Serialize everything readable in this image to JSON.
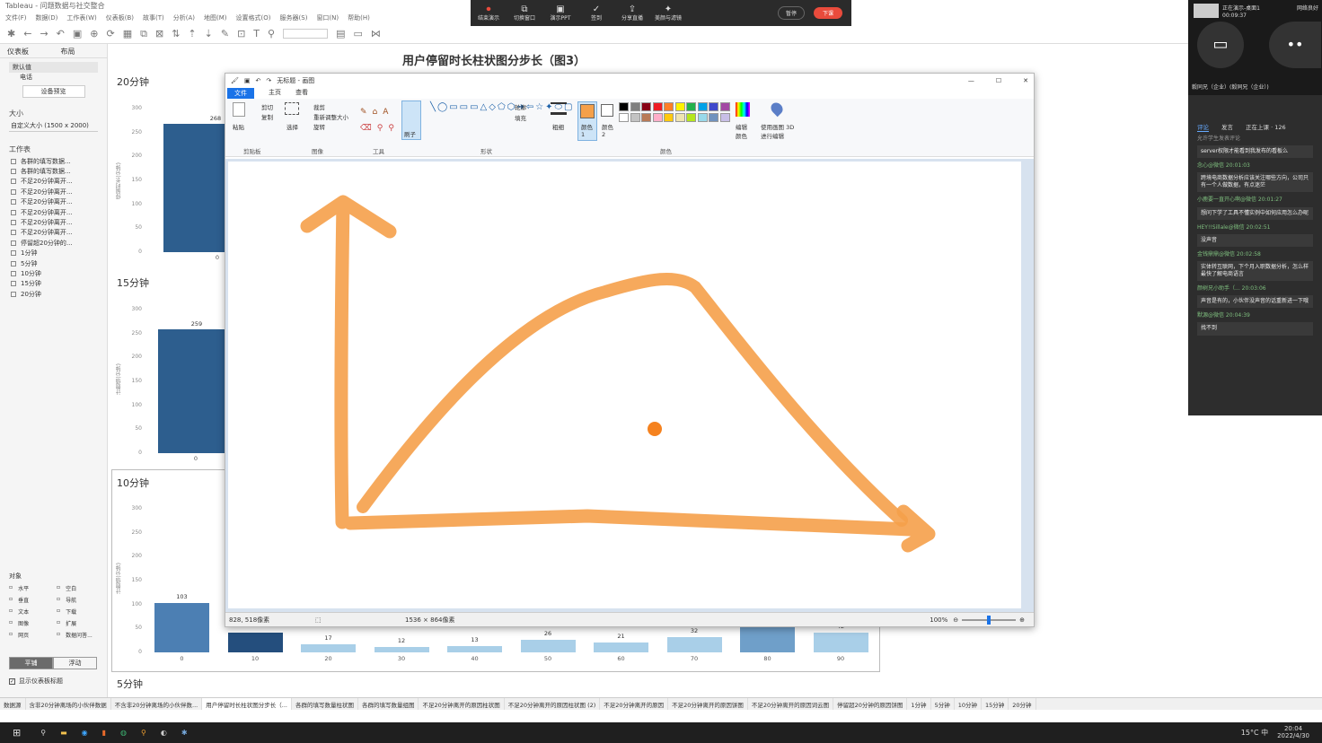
{
  "app": {
    "title": "Tableau - 问题数据与社交整合"
  },
  "menu": [
    "文件(F)",
    "数据(D)",
    "工作表(W)",
    "仪表板(B)",
    "故事(T)",
    "分析(A)",
    "地图(M)",
    "设置格式(O)",
    "服务器(S)",
    "窗口(N)",
    "帮助(H)"
  ],
  "left": {
    "tab_dashboard": "仪表板",
    "tab_layout": "布局",
    "device_default": "默认值",
    "device_phone": "电话",
    "device_preview": "设备预览",
    "size_header": "大小",
    "size_value": "自定义大小 (1500 x 2000)",
    "sheets_header": "工作表",
    "sheets": [
      "各群的填写数据...",
      "各群的填写数据...",
      "不足20分钟离开...",
      "不足20分钟离开...",
      "不足20分钟离开...",
      "不足20分钟离开...",
      "不足20分钟离开...",
      "不足20分钟离开...",
      "停留超20分钟的...",
      "1分钟",
      "5分钟",
      "10分钟",
      "15分钟",
      "20分钟"
    ],
    "objects_header": "对象",
    "objects": [
      "水平",
      "空白",
      "垂直",
      "导航",
      "文本",
      "下载",
      "图像",
      "扩展",
      "网页",
      "数据问答..."
    ],
    "tiled": "平铺",
    "floating": "浮动",
    "show_title": "显示仪表板标题"
  },
  "dashboard": {
    "title": "用户停留时长柱状图分步长（图3）",
    "panels": [
      {
        "label": "20分钟",
        "bar_value": "268",
        "x0": "0",
        "yaxis": "停留时长(分钟)",
        "ticks": [
          "300",
          "250",
          "200",
          "150",
          "100",
          "50",
          "0"
        ]
      },
      {
        "label": "15分钟",
        "bar_value": "259",
        "x0": "0",
        "yaxis": "计数值(分钟)",
        "ticks": [
          "300",
          "250",
          "200",
          "150",
          "100",
          "50",
          "0"
        ]
      },
      {
        "label": "10分钟",
        "yaxis": "计数值(分钟)",
        "ticks": [
          "300",
          "250",
          "200",
          "150",
          "100",
          "50",
          "0"
        ]
      }
    ],
    "bottom_label": "5分钟"
  },
  "chart_data": [
    {
      "type": "bar",
      "title": "20分钟",
      "categories": [
        "0"
      ],
      "values": [
        268
      ],
      "ylim": [
        0,
        300
      ]
    },
    {
      "type": "bar",
      "title": "15分钟",
      "categories": [
        "0"
      ],
      "values": [
        259
      ],
      "ylim": [
        0,
        300
      ]
    },
    {
      "type": "bar",
      "title": "10分钟",
      "categories": [
        "0",
        "10",
        "20",
        "30",
        "40",
        "50",
        "60",
        "70",
        "80",
        "90"
      ],
      "values": [
        103,
        42,
        17,
        12,
        13,
        26,
        21,
        32,
        68,
        42
      ],
      "labels": [
        "103",
        "",
        "17",
        "12",
        "13",
        "26",
        "21",
        "32",
        "",
        "42"
      ],
      "ylim": [
        0,
        300
      ]
    }
  ],
  "paint": {
    "title": "无标题 - 画图",
    "tabs": [
      "文件",
      "主页",
      "查看"
    ],
    "groups": [
      "剪贴板",
      "图像",
      "工具",
      "形状",
      "颜色"
    ],
    "clipboard": {
      "paste": "粘贴",
      "cut": "剪切",
      "copy": "复制"
    },
    "image": {
      "select": "选择",
      "crop": "裁剪",
      "resize": "重新调整大小",
      "rotate": "旋转"
    },
    "brush": "刷子",
    "outline": "轮廓",
    "fill": "填充",
    "size": "粗细",
    "color1": "颜色 1",
    "color2": "颜色 2",
    "edit_colors": "编辑颜色",
    "paint3d": "使用画图 3D 进行编辑",
    "status_pos": "828, 518像素",
    "status_size": "1536 × 864像素",
    "zoom": "100%",
    "accent": "#f5a04a",
    "palette": [
      "#000000",
      "#7f7f7f",
      "#880015",
      "#ed1c24",
      "#ff7f27",
      "#fff200",
      "#22b14c",
      "#00a2e8",
      "#3f48cc",
      "#a349a4",
      "#ffffff",
      "#c3c3c3",
      "#b97a57",
      "#ffaec9",
      "#ffc90e",
      "#efe4b0",
      "#b5e61d",
      "#99d9ea",
      "#7092be",
      "#c8bfe7"
    ]
  },
  "recorder": {
    "items": [
      "结束演示",
      "切换窗口",
      "演示PPT",
      "签到",
      "分享直播",
      "美颜与滤镜"
    ],
    "pause": "暂停",
    "end": "下课"
  },
  "live": {
    "status": "正在演示-桌面1",
    "time": "00:09:37",
    "network": "网络良好",
    "host": "毅同兄（企业）(毅同兄（企业）)",
    "tabs": [
      "评论",
      "发言",
      "正在上课 · 126"
    ],
    "filter": "允许学生发表评论",
    "comments": [
      {
        "who": "",
        "msg": "server权限才能看到我发布的看板么"
      },
      {
        "who": "念心@微信  20:01:03",
        "msg": "跨境电商数据分析应该关注哪些方向，公司只有一个人做数据，有点迷茫"
      },
      {
        "who": "小鹿要一直开心啊@微信  20:01:27",
        "msg": "想问下学了工具不懂实例中如何应用怎么办呢"
      },
      {
        "who": "HEY!!Sillale@微信  20:02:51",
        "msg": "没声音"
      },
      {
        "who": "金钱鼎鼎@微信  20:02:58",
        "msg": "实体转互联网，下个月入职数据分析，怎么样最快了解电商语言"
      },
      {
        "who": "颜树兄小助手（...  20:03:06",
        "msg": "声音是有的，小伙伴没声音的话重新进一下哦"
      },
      {
        "who": "默源@微信  20:04:39",
        "msg": "找不到"
      }
    ]
  },
  "sheet_tabs": [
    "数据源",
    "含非20分钟离场的小伙伴数据",
    "不含非20分钟离场的小伙伴数...",
    "用户停留时长柱状图分步长（...",
    "各群的填写数量柱状图",
    "各群的填写数量组图",
    "不足20分钟离开的原因柱状图",
    "不足20分钟离开的原因柱状图 (2)",
    "不足20分钟离开的原因",
    "不足20分钟离开的原因饼图",
    "不足20分钟离开的原因词云图",
    "停留超20分钟的原因饼图",
    "1分钟",
    "5分钟",
    "10分钟",
    "15分钟",
    "20分钟"
  ],
  "taskbar": {
    "weather": "15°C 中",
    "time": "20:04",
    "date": "2022/4/30"
  }
}
